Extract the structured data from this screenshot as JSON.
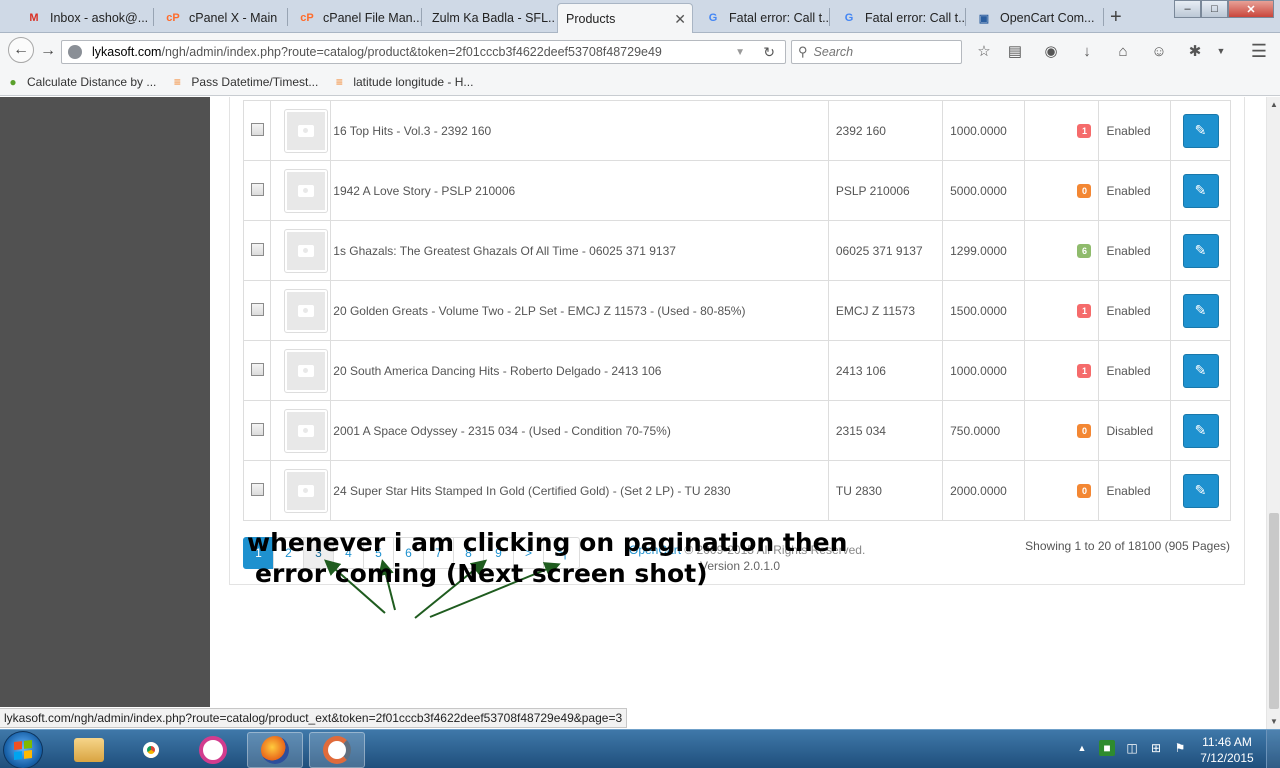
{
  "browser": {
    "tabs": [
      {
        "label": "Inbox - ashok@...",
        "icon": "gmail-icon",
        "icon_glyph": "M",
        "icon_color": "#d93025"
      },
      {
        "label": "cPanel X - Main",
        "icon": "cpanel-icon",
        "icon_glyph": "cP",
        "icon_color": "#ff6c2c"
      },
      {
        "label": "cPanel File Man...",
        "icon": "cpanel-icon",
        "icon_glyph": "cP",
        "icon_color": "#ff6c2c"
      },
      {
        "label": "Zulm Ka Badla - SFL...",
        "icon": "",
        "icon_glyph": "",
        "icon_color": ""
      },
      {
        "label": "Products",
        "icon": "",
        "icon_glyph": "",
        "icon_color": "",
        "active": true
      },
      {
        "label": "Fatal error: Call t...",
        "icon": "google-icon",
        "icon_glyph": "G",
        "icon_color": "#4285f4"
      },
      {
        "label": "Fatal error: Call t...",
        "icon": "google-icon",
        "icon_glyph": "G",
        "icon_color": "#4285f4"
      },
      {
        "label": "OpenCart Com...",
        "icon": "opencart-icon",
        "icon_glyph": "▣",
        "icon_color": "#2a5d9f"
      }
    ],
    "url_host": "lykasoft.com",
    "url_path": "/ngh/admin/index.php?route=catalog/product&token=2f01cccb3f4622deef53708f48729e49",
    "search_placeholder": "Search",
    "bookmarks": [
      {
        "label": "Calculate Distance by ...",
        "icon": "earth-icon",
        "glyph": "●",
        "color": "#5aa02c"
      },
      {
        "label": "Pass Datetime/Timest...",
        "icon": "stackoverflow-icon",
        "glyph": "≡",
        "color": "#f48024"
      },
      {
        "label": "latitude longitude - H...",
        "icon": "stackoverflow-icon",
        "glyph": "≡",
        "color": "#f48024"
      }
    ]
  },
  "products": [
    {
      "name": "16 Top Hits - Vol.3 - 2392 160",
      "model": "2392 160",
      "price": "1000.0000",
      "quantity": "1",
      "qty_color": "#f56b6b",
      "status": "Enabled"
    },
    {
      "name": "1942 A Love Story - PSLP 210006",
      "model": "PSLP 210006",
      "price": "5000.0000",
      "quantity": "0",
      "qty_color": "#f38733",
      "status": "Enabled"
    },
    {
      "name": "1s Ghazals: The Greatest Ghazals Of All Time - 06025 371 9137",
      "model": "06025 371 9137",
      "price": "1299.0000",
      "quantity": "6",
      "qty_color": "#8fbb6c",
      "status": "Enabled"
    },
    {
      "name": "20 Golden Greats - Volume Two - 2LP Set - EMCJ Z 11573 - (Used - 80-85%)",
      "model": "EMCJ Z 11573",
      "price": "1500.0000",
      "quantity": "1",
      "qty_color": "#f56b6b",
      "status": "Enabled"
    },
    {
      "name": "20 South America Dancing Hits - Roberto Delgado - 2413 106",
      "model": "2413 106",
      "price": "1000.0000",
      "quantity": "1",
      "qty_color": "#f56b6b",
      "status": "Enabled"
    },
    {
      "name": "2001 A Space Odyssey - 2315 034 - (Used - Condition 70-75%)",
      "model": "2315 034",
      "price": "750.0000",
      "quantity": "0",
      "qty_color": "#f38733",
      "status": "Disabled"
    },
    {
      "name": "24 Super Star Hits Stamped In Gold (Certified Gold) - (Set 2 LP) - TU 2830",
      "model": "TU 2830",
      "price": "2000.0000",
      "quantity": "0",
      "qty_color": "#f38733",
      "status": "Enabled"
    }
  ],
  "pagination": {
    "pages": [
      "1",
      "2",
      "3",
      "4",
      "5",
      "6",
      "7",
      "8",
      "9",
      ">",
      ">|"
    ],
    "active": "1",
    "hovered": "3",
    "summary": "Showing 1 to 20 of 18100 (905 Pages)"
  },
  "footer": {
    "link": "OpenCart",
    "copyright": " © 2009-2015 All Rights Reserved.",
    "version": "Version 2.0.1.0"
  },
  "annotation": {
    "line1": "whenever i am clicking on pagination then",
    "line2": "error coming (Next screen shot)"
  },
  "status_url": "lykasoft.com/ngh/admin/index.php?route=catalog/product_ext&token=2f01cccb3f4622deef53708f48729e49&page=3",
  "taskbar": {
    "apps": [
      "explorer-icon",
      "chrome-icon",
      "network-app-icon",
      "firefox-icon",
      "app-icon"
    ],
    "time": "11:46 AM",
    "date": "7/12/2015"
  },
  "colors": {
    "accent": "#1e91cf",
    "sidebar": "#515151"
  }
}
